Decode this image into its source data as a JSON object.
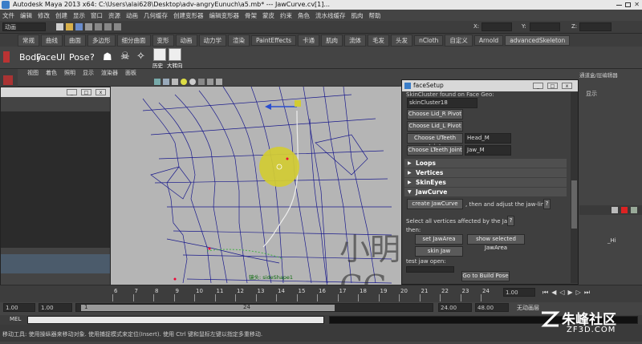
{
  "app": {
    "title": "Autodesk Maya 2013 x64: C:\\Users\\alai628\\Desktop\\adv-angryEunuch\\a5.mb*   ---   JawCurve.cv[1]..."
  },
  "menubar": [
    "文件",
    "编辑",
    "修改",
    "创建",
    "显示",
    "窗口",
    "资源",
    "动画",
    "几何缓存",
    "创建变形器",
    "编辑变形器",
    "骨架",
    "蒙皮",
    "约束",
    "角色",
    "流水线缓存",
    "肌肉",
    "帮助"
  ],
  "statusline": {
    "mode": "动画",
    "x_label": "X:",
    "y_label": "Y:",
    "z_label": "Z:"
  },
  "shelf_tabs": [
    "常规",
    "曲线",
    "曲面",
    "多边形",
    "细分曲面",
    "变形",
    "动画",
    "动力学",
    "渲染",
    "PaintEffects",
    "卡通",
    "肌肉",
    "流体",
    "毛发",
    "头发",
    "nCloth",
    "自定义",
    "Arnold",
    "advancedSkeleton"
  ],
  "shelf_active": "advancedSkeleton",
  "shelf_buttons": {
    "body": "Body",
    "face": "Face",
    "ui": "UI",
    "pose": "Pose",
    "help": "?",
    "history": "历史",
    "bigmirror": "大转向"
  },
  "viewport": {
    "menu": [
      "视图",
      "着色",
      "照明",
      "显示",
      "渲染器",
      "面板"
    ],
    "annotation": "镜头: sideShape1",
    "watermark": "小明CG"
  },
  "right_panel": {
    "label_top": "通道盒/层编辑器",
    "label_mid": "显示",
    "hi_label": "_Hi"
  },
  "face_setup": {
    "title": "faceSetup",
    "skin_header": "SkinCluster found on Face Geo:",
    "skin_field": "skinCluster18",
    "buttons": {
      "lid_r": "Choose Lid_R Pivot",
      "lid_l": "Choose Lid_L Pivot",
      "uteeth": "Choose UTeeth Joint",
      "lteeth": "Choose LTeeth Joint",
      "create_jawcurve": "create JawCurve",
      "help1": "?",
      "help2": "?",
      "set_jaw_area": "set JawArea",
      "show_jaw_area": "show selected JawArea",
      "skin_jaw": "skin Jaw",
      "to_build_pose": "Go to Build Pose"
    },
    "fields": {
      "uteeth_value": "Head_M",
      "lteeth_value": "Jaw_M"
    },
    "sections": [
      "Loops",
      "Vertices",
      "SkinEyes",
      "JawCurve"
    ],
    "texts": {
      "adjust": ", then and adjust the jaw-line",
      "select_all": "Select all vertices affected by the Jaw",
      "then": "then:",
      "test_jaw": "test jaw open:"
    }
  },
  "timeline": {
    "ticks": [
      "6",
      "7",
      "8",
      "9",
      "10",
      "11",
      "12",
      "13",
      "14",
      "15",
      "16",
      "17",
      "18",
      "19",
      "20",
      "21",
      "22",
      "23",
      "24"
    ],
    "current_frame": "1.00"
  },
  "range": {
    "start": "1.00",
    "start2": "1.00",
    "slider_value": "1",
    "slider_end": "24",
    "end": "24.00",
    "end2": "48.00",
    "anim_layer": "无动画层"
  },
  "mel_label": "MEL",
  "helpline": "移动工具: 使用操纵器来移动对象. 使用捕捉模式来定位(Insert). 使用 Ctrl 键和鼠标左键以指定多重移动.",
  "brand_watermark": {
    "main": "朱峰社区",
    "sub": "ZF3D.COM"
  },
  "colors": {
    "accent": "#5d5d5d",
    "mesh": "#1a1a8c",
    "manip": "#d2cc33"
  }
}
